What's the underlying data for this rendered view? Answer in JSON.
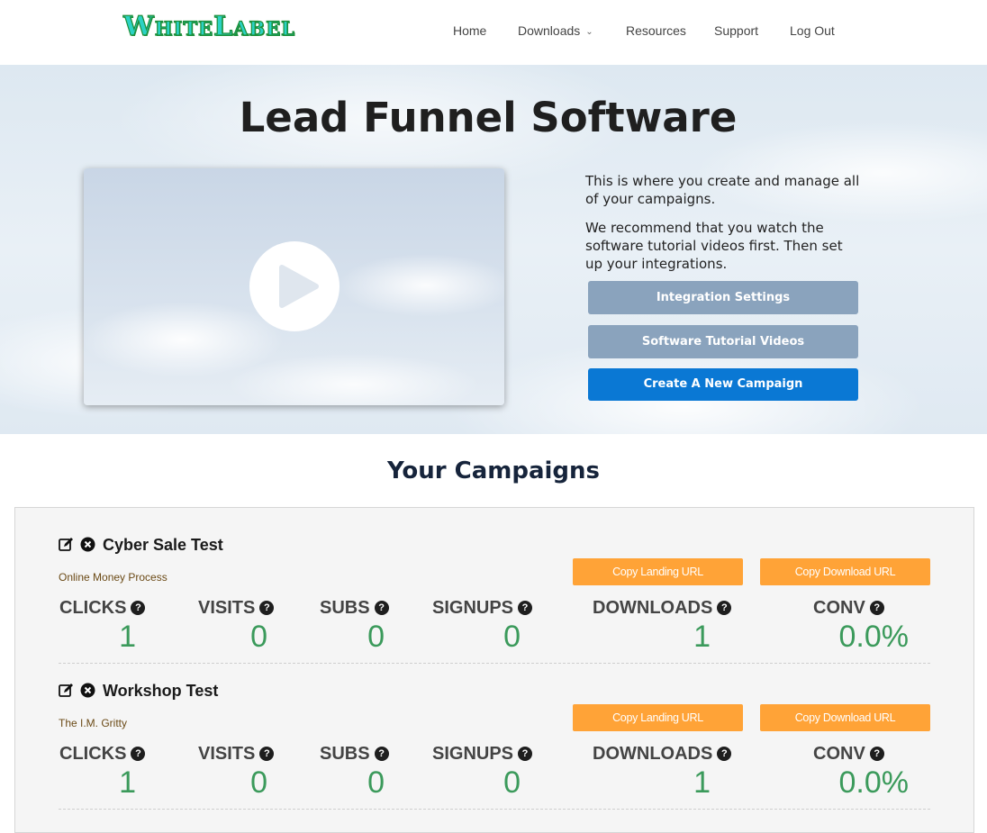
{
  "header": {
    "logo_text": "WhiteLabel",
    "nav": [
      {
        "label": "Home"
      },
      {
        "label": "Downloads",
        "has_dropdown": true
      },
      {
        "label": "Resources"
      },
      {
        "label": "Support"
      },
      {
        "label": "Log Out"
      }
    ]
  },
  "hero": {
    "title": "Lead Funnel Software",
    "paragraph1": "This is where you create and manage all of your campaigns.",
    "paragraph2": "We recommend that you watch the software tutorial videos first. Then set up your integrations.",
    "buttons": {
      "integration": "Integration Settings",
      "tutorials": "Software Tutorial Videos",
      "create": "Create A New Campaign"
    },
    "video": {
      "icon": "play-icon"
    }
  },
  "campaigns_section": {
    "title": "Your Campaigns",
    "copy_landing_label": "Copy Landing URL",
    "copy_download_label": "Copy Download URL",
    "stat_labels": {
      "clicks": "CLICKS",
      "visits": "VISITS",
      "subs": "SUBS",
      "signups": "SIGNUPS",
      "downloads": "DOWNLOADS",
      "conv": "CONV"
    },
    "help_glyph": "?",
    "campaigns": [
      {
        "name": "Cyber Sale Test",
        "subtitle": "Online Money Process",
        "clicks": "1",
        "visits": "0",
        "subs": "0",
        "signups": "0",
        "downloads": "1",
        "conv": "0.0%"
      },
      {
        "name": "Workshop Test",
        "subtitle": "The I.M. Gritty",
        "clicks": "1",
        "visits": "0",
        "subs": "0",
        "signups": "0",
        "downloads": "1",
        "conv": "0.0%"
      }
    ]
  },
  "colors": {
    "accent_blue": "#0a78d4",
    "button_gray": "#8aa3bd",
    "copy_orange": "#ffa337",
    "stat_green": "#3b9a5b"
  }
}
